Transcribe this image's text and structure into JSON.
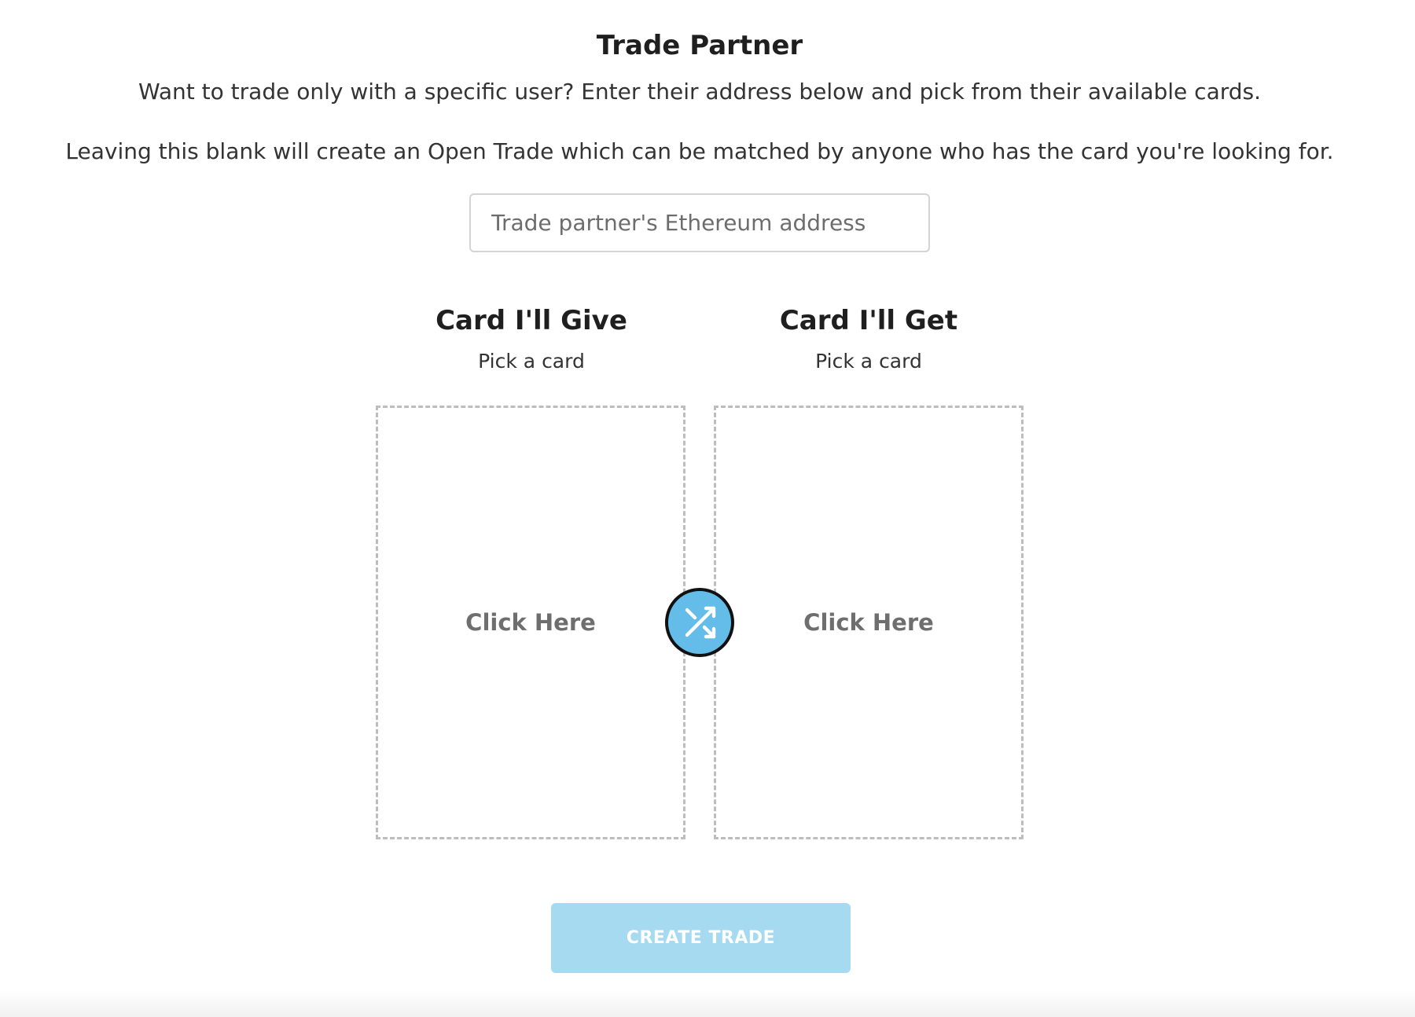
{
  "trade_partner": {
    "title": "Trade Partner",
    "description_1": "Want to trade only with a specific user? Enter their address below and pick from their available cards.",
    "description_2": "Leaving this blank will create an Open Trade which can be matched by anyone who has the card you're looking for.",
    "address_input": {
      "placeholder": "Trade partner's Ethereum address",
      "value": ""
    }
  },
  "give_card": {
    "title": "Card I'll Give",
    "subtitle": "Pick a card",
    "slot_label": "Click Here"
  },
  "get_card": {
    "title": "Card I'll Get",
    "subtitle": "Pick a card",
    "slot_label": "Click Here"
  },
  "swap_button": {
    "icon": "shuffle-icon",
    "color": "#64bde9"
  },
  "create_button": {
    "label": "CREATE TRADE",
    "color": "#a6daf1"
  }
}
